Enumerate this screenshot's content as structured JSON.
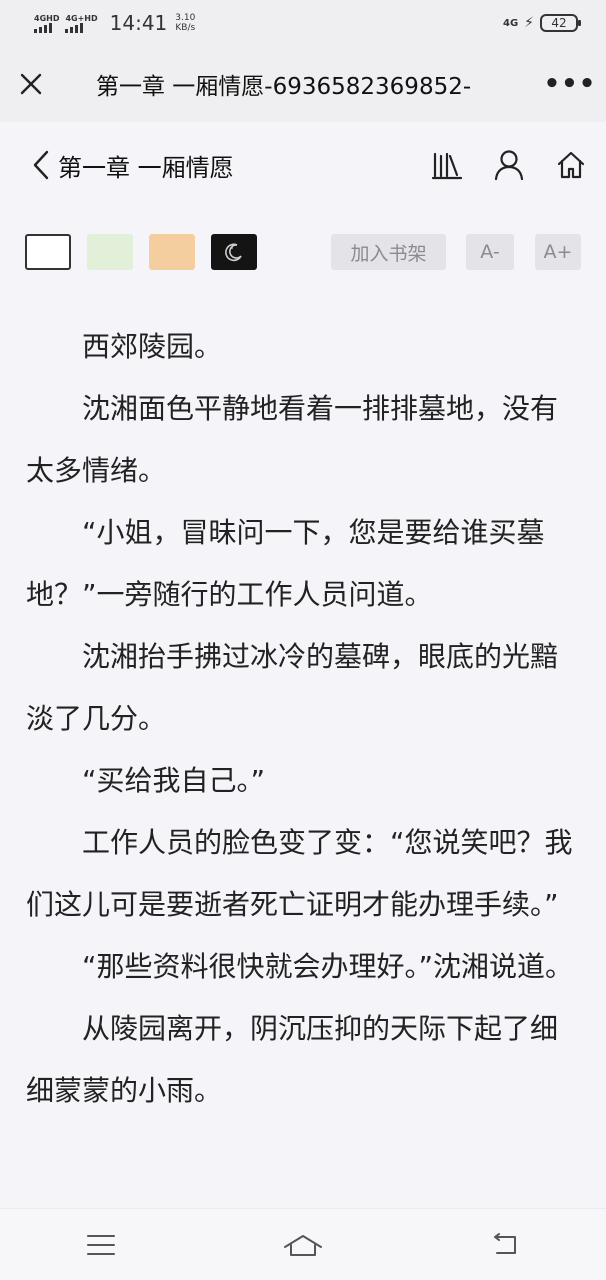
{
  "status": {
    "net1": "4GHD",
    "net2": "4G+HD",
    "time": "14:41",
    "speed_value": "3.10",
    "speed_unit": "KB/s",
    "net_right": "4G",
    "battery": "42"
  },
  "header": {
    "title": "第一章 一厢情愿-6936582369852-",
    "more": "•••"
  },
  "chapter": {
    "title": "第一章 一厢情愿"
  },
  "toolbar": {
    "add_shelf": "加入书架",
    "font_minus": "A-",
    "font_plus": "A+"
  },
  "content": {
    "paragraphs": [
      "西郊陵园。",
      "沈湘面色平静地看着一排排墓地，没有太多情绪。",
      "“小姐，冒昧问一下，您是要给谁买墓地？”一旁随行的工作人员问道。",
      "沈湘抬手拂过冰冷的墓碑，眼底的光黯淡了几分。",
      "“买给我自己。”",
      "工作人员的脸色变了变：“您说笑吧？我们这儿可是要逝者死亡证明才能办理手续。”",
      "“那些资料很快就会办理好。”沈湘说道。",
      "从陵园离开，阴沉压抑的天际下起了细细蒙蒙的小雨。"
    ]
  },
  "colors": {
    "swatch_white": "#ffffff",
    "swatch_green": "#e2efd9",
    "swatch_orange": "#f5cea0",
    "swatch_dark": "#141414"
  },
  "icons": {
    "close": "close-icon",
    "back": "chevron-left-icon",
    "bookshelf": "bookshelf-icon",
    "user": "user-icon",
    "home": "home-icon",
    "moon": "moon-icon",
    "menu": "menu-icon",
    "home_nav": "home-nav-icon",
    "back_nav": "back-nav-icon"
  }
}
